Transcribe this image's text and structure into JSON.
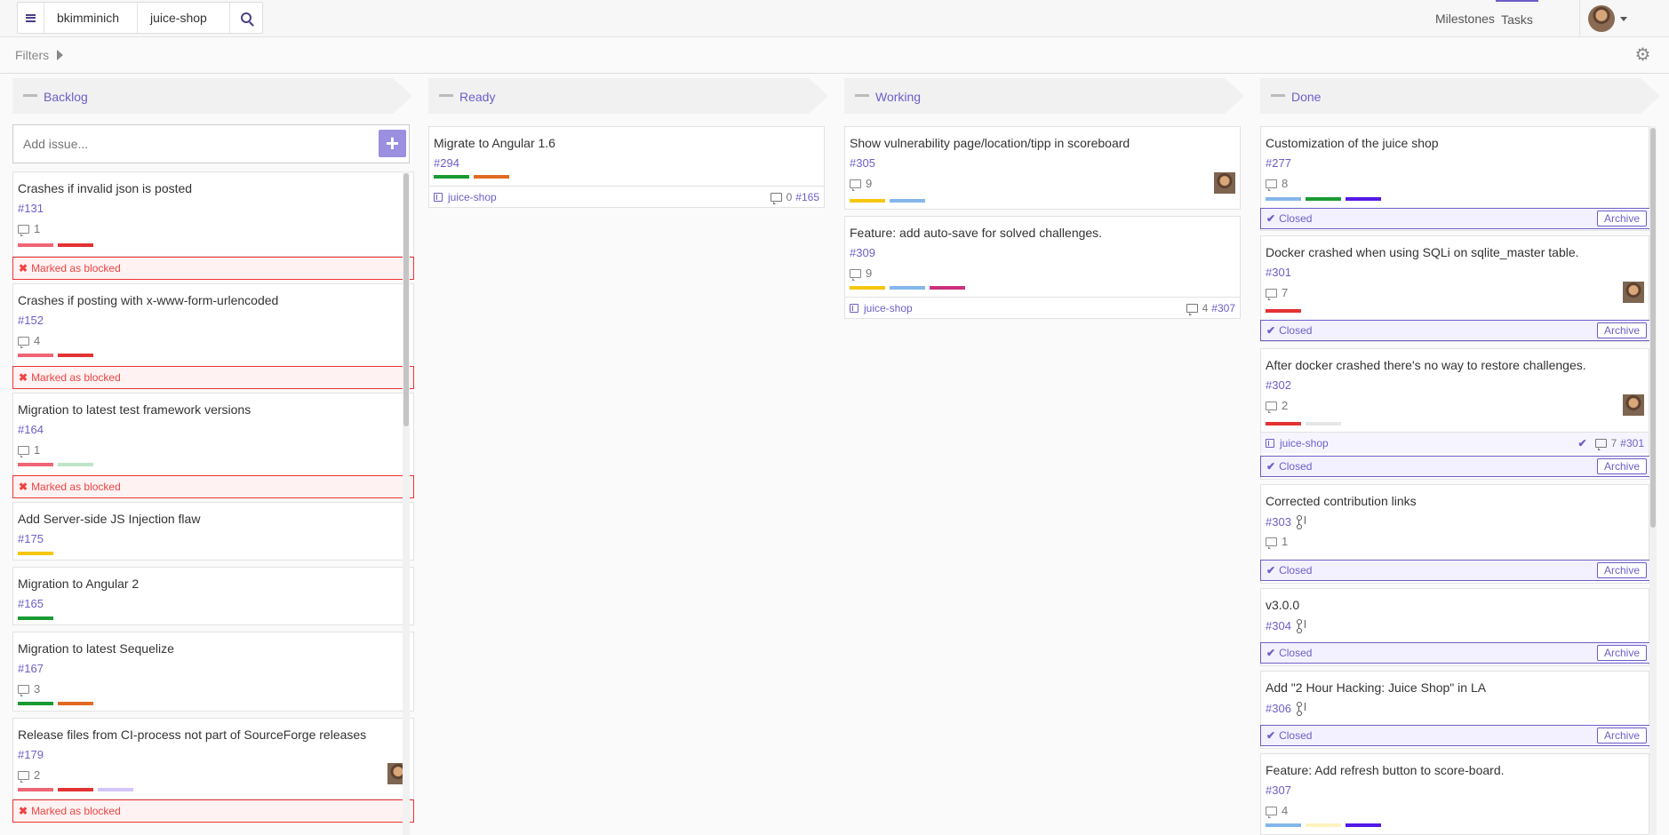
{
  "breadcrumb": {
    "user": "bkimminich",
    "repo": "juice-shop"
  },
  "nav": {
    "milestones": "Milestones",
    "tasks": "Tasks"
  },
  "filters": {
    "label": "Filters"
  },
  "colors": {
    "accent": "#6c5fc7",
    "blocked": "#e33",
    "label_green": "#1a9a32",
    "label_orange": "#e06a24",
    "label_red": "#e33232",
    "label_pink": "#f06575",
    "label_lightgreen": "#bfe5c8",
    "label_yellow": "#f5c60f",
    "label_lightblue": "#84b6eb",
    "label_magenta": "#cc317c",
    "label_purple": "#5319e7",
    "label_lavender": "#d4c5f9",
    "label_grey": "#e6e6e6",
    "label_paleyellow": "#fef2c0"
  },
  "columns": [
    {
      "title": "Backlog"
    },
    {
      "title": "Ready"
    },
    {
      "title": "Working"
    },
    {
      "title": "Done"
    }
  ],
  "add_issue": {
    "placeholder": "Add issue...",
    "button": "+"
  },
  "backlog": [
    {
      "title": "Crashes if invalid json is posted",
      "number": "#131",
      "comments": "1",
      "blocked": "Marked as blocked",
      "labels": [
        "label_pink",
        "label_red"
      ]
    },
    {
      "title": "Crashes if posting with x-www-form-urlencoded",
      "number": "#152",
      "comments": "4",
      "blocked": "Marked as blocked",
      "labels": [
        "label_pink",
        "label_red"
      ]
    },
    {
      "title": "Migration to latest test framework versions",
      "number": "#164",
      "comments": "1",
      "blocked": "Marked as blocked",
      "labels": [
        "label_pink",
        "label_lightgreen"
      ]
    },
    {
      "title": "Add Server-side JS Injection flaw",
      "number": "#175",
      "labels": [
        "label_yellow"
      ]
    },
    {
      "title": "Migration to Angular 2",
      "number": "#165",
      "labels": [
        "label_green"
      ]
    },
    {
      "title": "Migration to latest Sequelize",
      "number": "#167",
      "comments": "3",
      "labels": [
        "label_green",
        "label_orange"
      ]
    },
    {
      "title": "Release files from CI-process not part of SourceForge releases",
      "number": "#179",
      "comments": "2",
      "blocked": "Marked as blocked",
      "labels": [
        "label_pink",
        "label_red",
        "label_lavender"
      ]
    }
  ],
  "ready": [
    {
      "title": "Migrate to Angular 1.6",
      "number": "#294",
      "labels": [
        "label_green",
        "label_orange"
      ],
      "repo": "juice-shop",
      "foot_comments": "0",
      "foot_ref": "#165"
    }
  ],
  "working": [
    {
      "title": "Show vulnerability page/location/tipp in scoreboard",
      "number": "#305",
      "comments": "9",
      "labels": [
        "label_yellow",
        "label_lightblue"
      ]
    },
    {
      "title": "Feature: add auto-save for solved challenges.",
      "number": "#309",
      "comments": "9",
      "labels": [
        "label_yellow",
        "label_lightblue",
        "label_magenta"
      ],
      "repo": "juice-shop",
      "foot_comments": "4",
      "foot_ref": "#307"
    }
  ],
  "done": [
    {
      "title": "Customization of the juice shop",
      "number": "#277",
      "comments": "8",
      "labels": [
        "label_lightblue",
        "label_green",
        "label_purple"
      ],
      "closed": "Closed",
      "archive": "Archive"
    },
    {
      "title": "Docker crashed when using SQLi on sqlite_master table.",
      "number": "#301",
      "comments": "7",
      "labels": [
        "label_red"
      ],
      "closed": "Closed",
      "archive": "Archive"
    },
    {
      "title": "After docker crashed there's no way to restore challenges.",
      "number": "#302",
      "comments": "2",
      "labels": [
        "label_red",
        "label_grey"
      ],
      "repo": "juice-shop",
      "foot_comments": "7",
      "foot_ref": "#301",
      "closed": "Closed",
      "archive": "Archive"
    },
    {
      "title": "Corrected contribution links",
      "number": "#303",
      "comments": "1",
      "closed": "Closed",
      "archive": "Archive"
    },
    {
      "title": "v3.0.0",
      "number": "#304",
      "closed": "Closed",
      "archive": "Archive"
    },
    {
      "title": "Add \"2 Hour Hacking: Juice Shop\" in LA",
      "number": "#306",
      "closed": "Closed",
      "archive": "Archive"
    },
    {
      "title": "Feature: Add refresh button to score-board.",
      "number": "#307",
      "comments": "4",
      "labels": [
        "label_lightblue",
        "label_paleyellow",
        "label_purple"
      ]
    }
  ]
}
